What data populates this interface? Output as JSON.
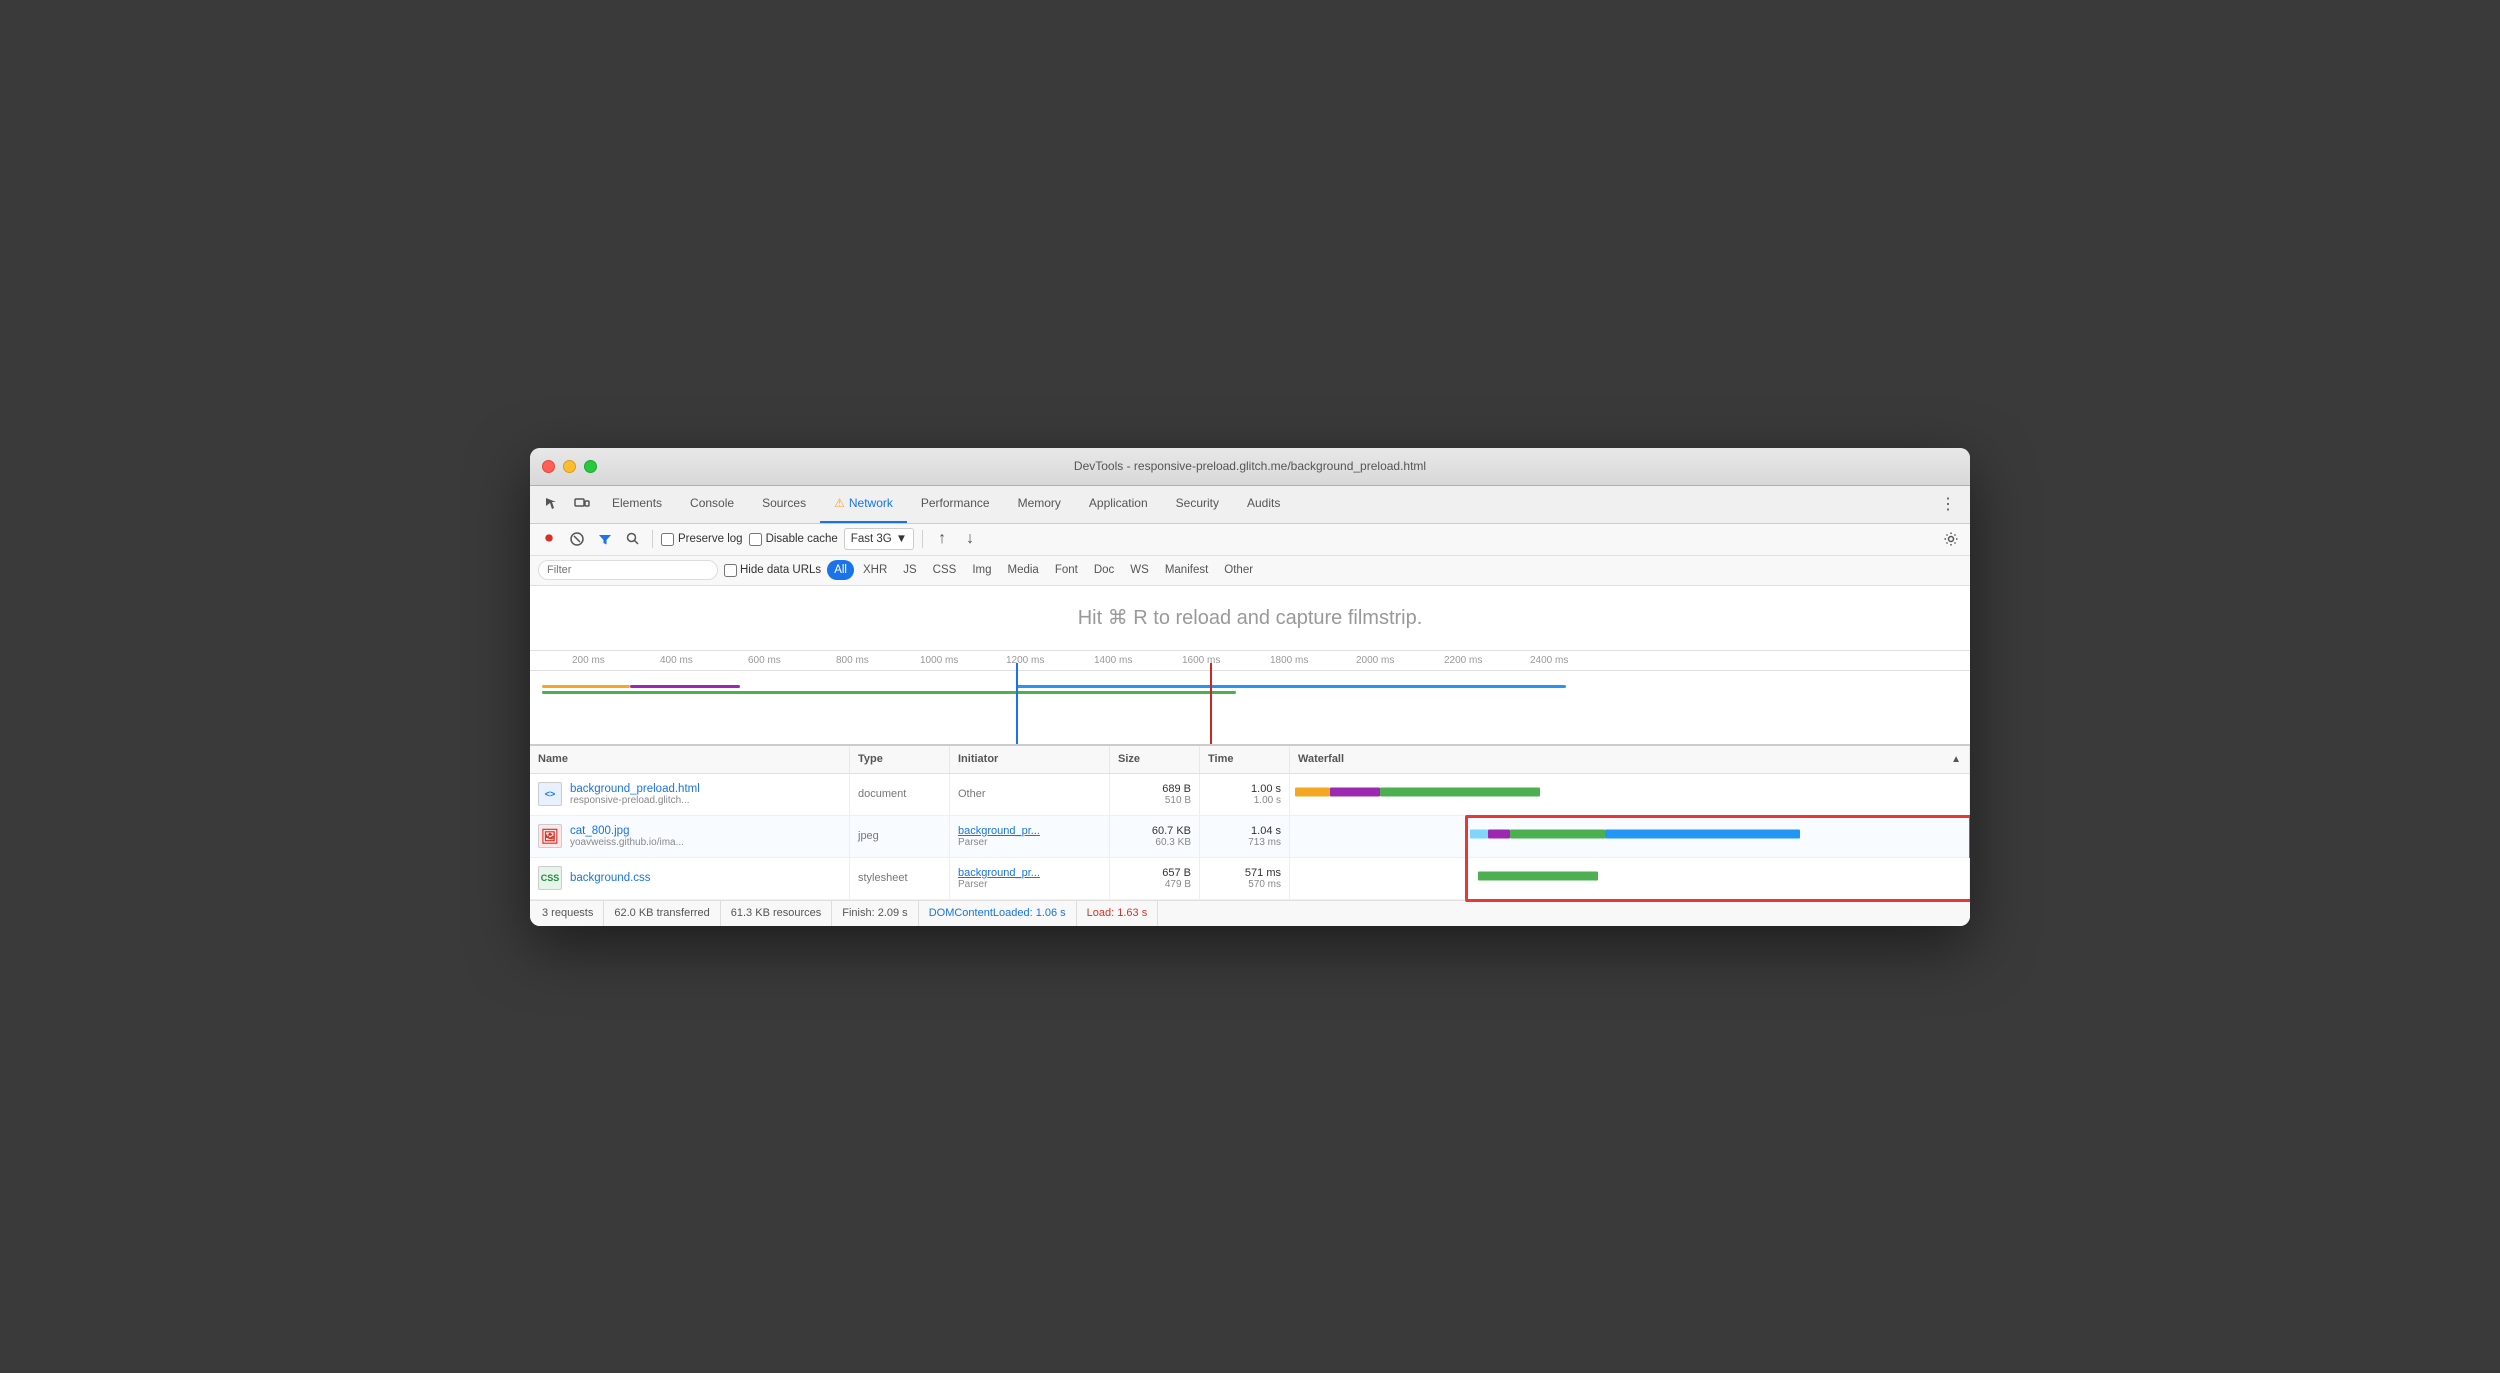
{
  "window": {
    "title": "DevTools - responsive-preload.glitch.me/background_preload.html"
  },
  "devtools_tabs": {
    "items": [
      {
        "id": "elements",
        "label": "Elements",
        "active": false
      },
      {
        "id": "console",
        "label": "Console",
        "active": false
      },
      {
        "id": "sources",
        "label": "Sources",
        "active": false
      },
      {
        "id": "network",
        "label": "Network",
        "active": true,
        "warn": true
      },
      {
        "id": "performance",
        "label": "Performance",
        "active": false
      },
      {
        "id": "memory",
        "label": "Memory",
        "active": false
      },
      {
        "id": "application",
        "label": "Application",
        "active": false
      },
      {
        "id": "security",
        "label": "Security",
        "active": false
      },
      {
        "id": "audits",
        "label": "Audits",
        "active": false
      }
    ]
  },
  "toolbar": {
    "preserve_log": "Preserve log",
    "disable_cache": "Disable cache",
    "throttle": "Fast 3G"
  },
  "filter_bar": {
    "placeholder": "Filter",
    "hide_data_urls": "Hide data URLs",
    "types": [
      "All",
      "XHR",
      "JS",
      "CSS",
      "Img",
      "Media",
      "Font",
      "Doc",
      "WS",
      "Manifest",
      "Other"
    ]
  },
  "filmstrip": {
    "hint": "Hit ⌘ R to reload and capture filmstrip."
  },
  "timeline": {
    "marks": [
      "200 ms",
      "400 ms",
      "600 ms",
      "800 ms",
      "1000 ms",
      "1200 ms",
      "1400 ms",
      "1600 ms",
      "1800 ms",
      "2000 ms",
      "2200 ms",
      "2400 ms"
    ]
  },
  "table": {
    "columns": [
      "Name",
      "Type",
      "Initiator",
      "Size",
      "Time",
      "Waterfall"
    ],
    "rows": [
      {
        "icon_type": "html",
        "icon_label": "< >",
        "name": "background_preload.html",
        "name_sub": "responsive-preload.glitch...",
        "type": "document",
        "initiator": "Other",
        "initiator_sub": "",
        "size": "689 B",
        "size_sub": "510 B",
        "time": "1.00 s",
        "time_sub": "1.00 s"
      },
      {
        "icon_type": "img",
        "icon_label": "🖼",
        "name": "cat_800.jpg",
        "name_sub": "yoavweiss.github.io/ima...",
        "type": "jpeg",
        "initiator": "background_pr...",
        "initiator_sub": "Parser",
        "size": "60.7 KB",
        "size_sub": "60.3 KB",
        "time": "1.04 s",
        "time_sub": "713 ms"
      },
      {
        "icon_type": "css",
        "icon_label": "CSS",
        "name": "background.css",
        "name_sub": "",
        "type": "stylesheet",
        "initiator": "background_pr...",
        "initiator_sub": "Parser",
        "size": "657 B",
        "size_sub": "479 B",
        "time": "571 ms",
        "time_sub": "570 ms"
      }
    ]
  },
  "status_bar": {
    "requests": "3 requests",
    "transferred": "62.0 KB transferred",
    "resources": "61.3 KB resources",
    "finish": "Finish: 2.09 s",
    "dom_content_loaded": "DOMContentLoaded: 1.06 s",
    "load": "Load: 1.63 s"
  }
}
